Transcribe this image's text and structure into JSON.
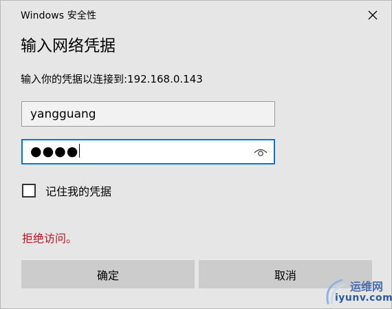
{
  "window": {
    "title": "Windows 安全性",
    "close_icon": "close-icon"
  },
  "heading": "输入网络凭据",
  "prompt": "输入你的凭据以连接到:192.168.0.143",
  "username": {
    "value": "yangguang"
  },
  "password": {
    "masked_value": "●●●●",
    "reveal_icon": "eye-icon"
  },
  "remember": {
    "label": "记住我的凭据",
    "checked": false
  },
  "error_message": "拒绝访问。",
  "buttons": {
    "ok_label": "确定",
    "cancel_label": "取消"
  },
  "watermark": {
    "cn": "运维网",
    "en": "iyunv.com"
  },
  "colors": {
    "dialog_background": "#e6e6e6",
    "focus_border": "#0078d7",
    "error_text": "#c50f1f",
    "button_background": "#cccccc"
  }
}
